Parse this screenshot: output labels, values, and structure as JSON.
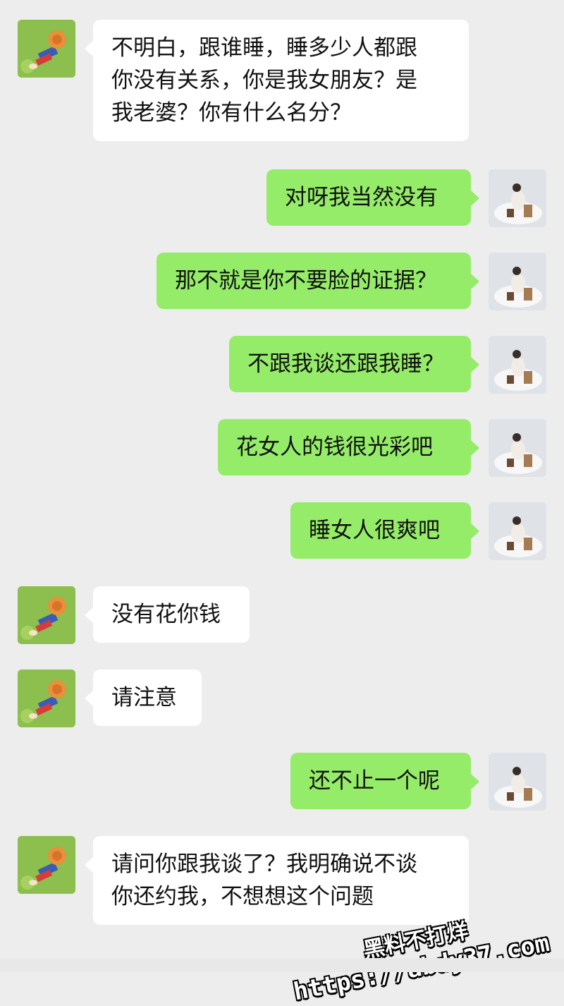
{
  "messages": [
    {
      "side": "left",
      "text": "不明白，跟谁睡，睡多少人都跟\n你没有关系，你是我女朋友？是\n我老婆？你有什么名分？"
    },
    {
      "side": "right",
      "text": "对呀我当然没有"
    },
    {
      "side": "right",
      "text": "那不就是你不要脸的证据？"
    },
    {
      "side": "right",
      "text": "不跟我谈还跟我睡？"
    },
    {
      "side": "right",
      "text": "花女人的钱很光彩吧"
    },
    {
      "side": "right",
      "text": "睡女人很爽吧"
    },
    {
      "side": "left",
      "text": "没有花你钱"
    },
    {
      "side": "left",
      "text": "请注意"
    },
    {
      "side": "right",
      "text": "还不止一个呢"
    },
    {
      "side": "left",
      "text": "请问你跟我谈了？我明确说不谈\n你还约我，不想想这个问题"
    }
  ],
  "watermark": {
    "line1": "黑料不打烊",
    "line2": "https://abdy37.com"
  },
  "colors": {
    "background": "#ededed",
    "sent_bubble": "#95ec69",
    "received_bubble": "#ffffff"
  },
  "icons": {
    "left_avatar": "cartoon-straw-hat-avatar-icon",
    "right_avatar": "photo-avatar-icon"
  }
}
